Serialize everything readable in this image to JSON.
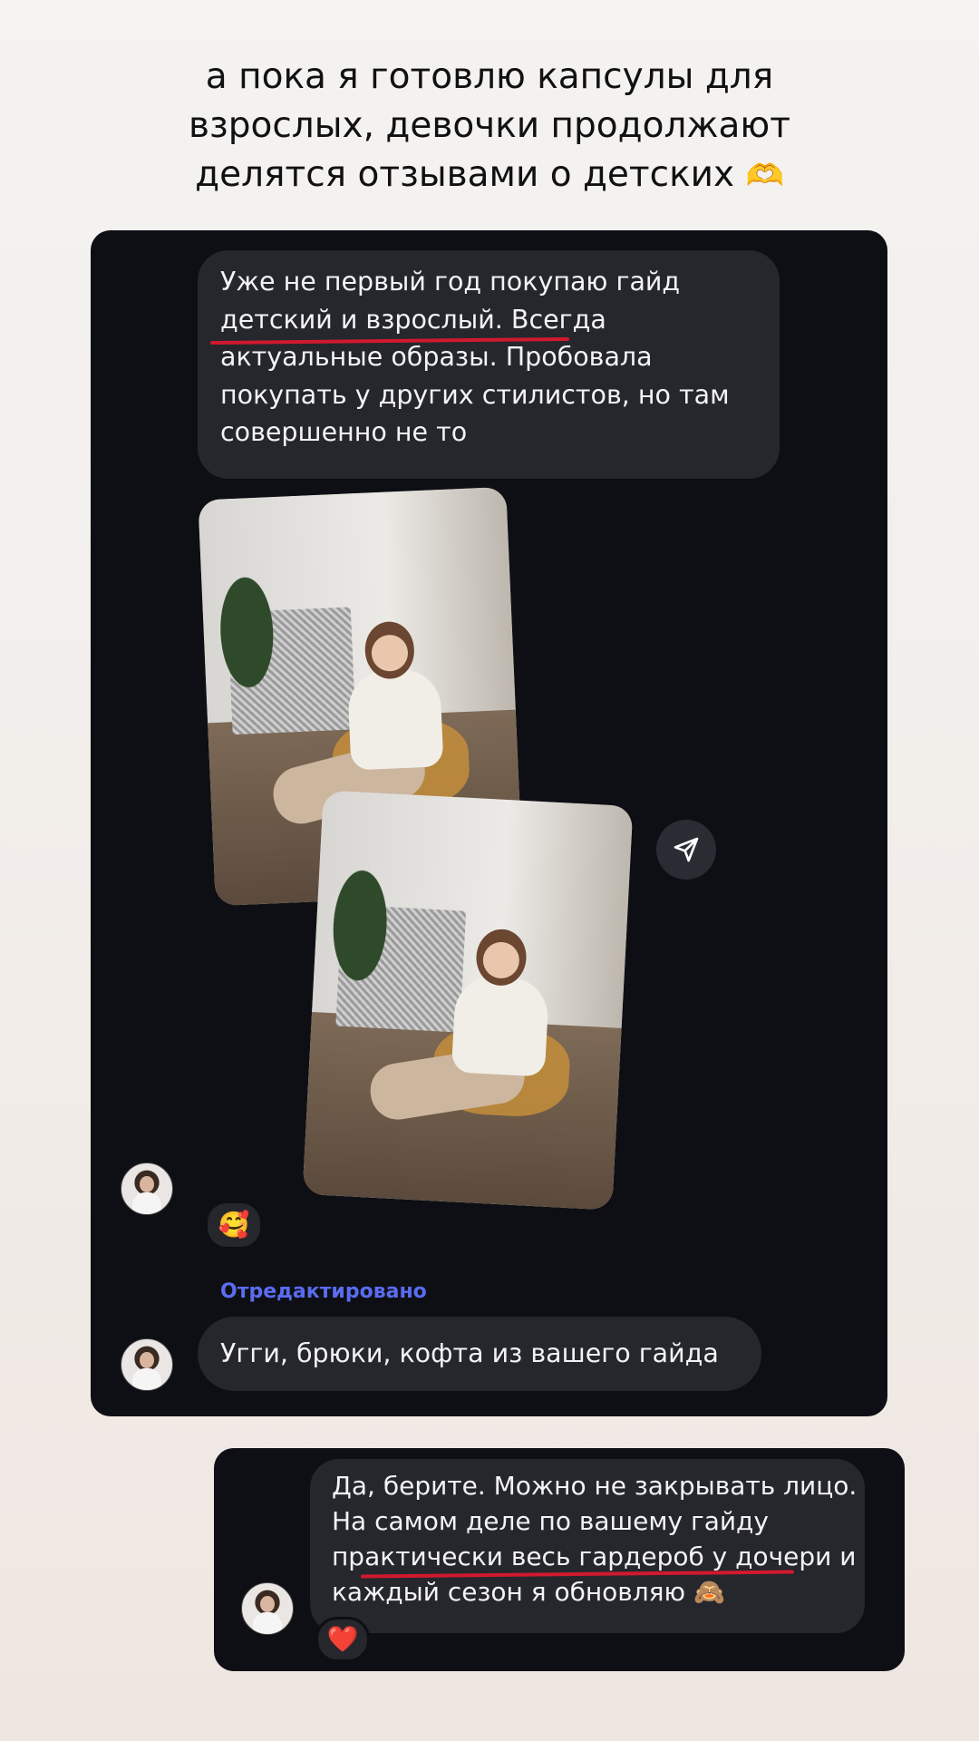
{
  "headline": {
    "lines": [
      "а пока я готовлю капсулы для",
      "взрослых, девочки продолжают",
      "делятся отзывами о детских"
    ],
    "emoji": "🫶"
  },
  "chat1": {
    "message1": {
      "lines": [
        "Уже не первый год покупаю гайд",
        "детский и взрослый. Всегда",
        "актуальные образы. Пробовала",
        "покупать у других стилистов, но там",
        "совершенно не то"
      ]
    },
    "photos": [
      "photo",
      "photo"
    ],
    "reaction_emoji": "🥰",
    "edited_label": "Отредактировано",
    "message2": "Угги, брюки, кофта из вашего гайда"
  },
  "chat2": {
    "message": {
      "lines": [
        "Да, берите. Можно не закрывать лицо.",
        "На самом деле по вашему гайду",
        "практически весь гардероб у дочери и",
        "каждый сезон я обновляю"
      ],
      "emoji": "🙈"
    },
    "reaction_emoji": "❤️"
  },
  "colors": {
    "card_bg": "#0e0f15",
    "bubble_bg": "#25272d",
    "underline": "#d1192e",
    "edited": "#5a6cf0"
  },
  "icons": {
    "share": "paper-plane-icon"
  }
}
